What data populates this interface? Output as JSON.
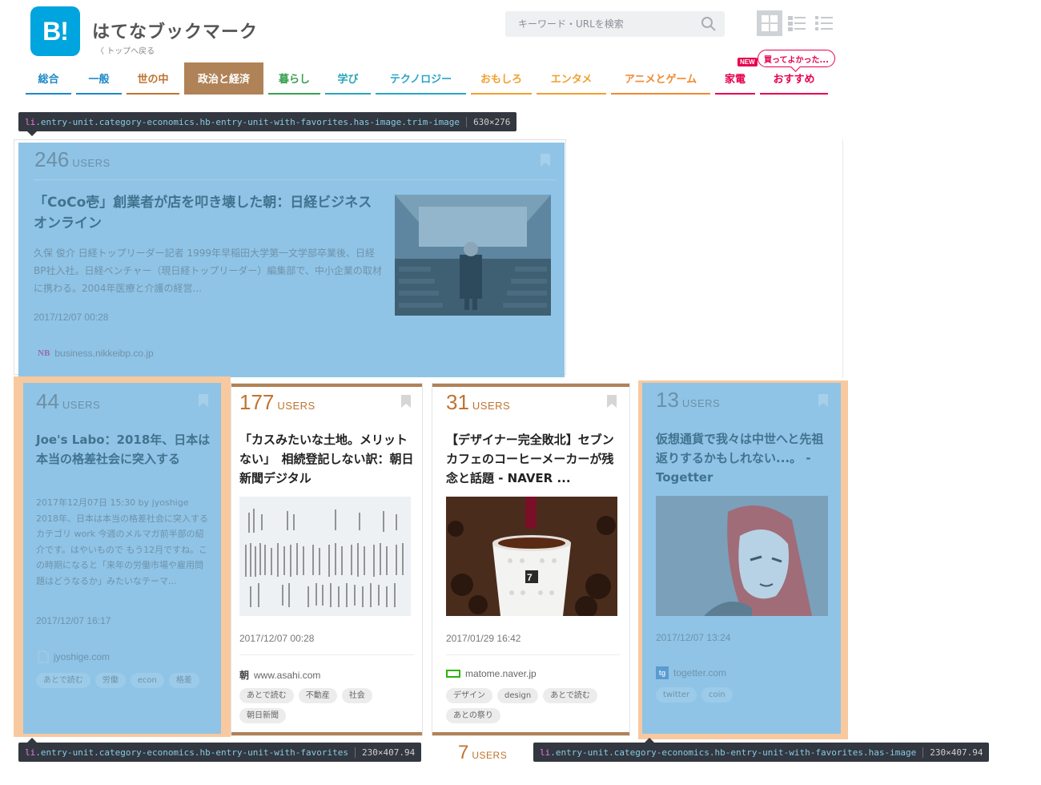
{
  "header": {
    "logo_text": "B!",
    "site_title": "はてなブックマーク",
    "back_link": "〈 トップへ戻る",
    "search_placeholder": "キーワード・URLを検索"
  },
  "nav": {
    "items": [
      {
        "label": "総合",
        "color": "#1e88c8"
      },
      {
        "label": "一般",
        "color": "#1e88c8"
      },
      {
        "label": "世の中",
        "color": "#c0732f"
      },
      {
        "label": "政治と経済",
        "color": "#b08257"
      },
      {
        "label": "暮らし",
        "color": "#3aa050"
      },
      {
        "label": "学び",
        "color": "#2aa6b8"
      },
      {
        "label": "テクノロジー",
        "color": "#2aa6c8"
      },
      {
        "label": "おもしろ",
        "color": "#f0a030"
      },
      {
        "label": "エンタメ",
        "color": "#f0a030"
      },
      {
        "label": "アニメとゲーム",
        "color": "#f08a30"
      },
      {
        "label": "家電",
        "color": "#e6004e"
      },
      {
        "label": "おすすめ",
        "color": "#e6004e"
      }
    ],
    "new_badge": "NEW",
    "bubble_text": "買ってよかった..."
  },
  "tooltips": {
    "top": {
      "selector_tag": "li",
      "selector_rest": ".entry-unit.category-economics.hb-entry-unit-with-favorites.has-image.trim-image",
      "size": "630×276"
    },
    "bottom_left": {
      "selector_tag": "li",
      "selector_rest": ".entry-unit.category-economics.hb-entry-unit-with-favorites",
      "size": "230×407.94"
    },
    "bottom_right": {
      "selector_tag": "li",
      "selector_rest": ".entry-unit.category-economics.hb-entry-unit-with-favorites.has-image",
      "size": "230×407.94"
    }
  },
  "entries": [
    {
      "users": "246",
      "users_label": "USERS",
      "title": "「CoCo壱」創業者が店を叩き壊した朝：日経ビジネスオンライン",
      "description": "久保 俊介 日経トップリーダー記者 1999年早稲田大学第一文学部卒業後、日経BP社入社。日経ベンチャー（現日経トップリーダー）編集部で、中小企業の取材に携わる。2004年医療と介護の経営...",
      "date": "2017/12/07 00:28",
      "favicon": "NB",
      "domain": "business.nikkeibp.co.jp",
      "tags": []
    },
    {
      "users": "44",
      "users_label": "USERS",
      "title": "Joe's Labo：2018年、日本は本当の格差社会に突入する",
      "description": "2017年12月07日 15:30 by jyoshige 2018年、日本は本当の格差社会に突入する カテゴリ work 今週のメルマガ前半部の紹介です。はやいもので もう12月ですね。この時期になると「来年の労働市場や雇用問題はどうなるか」みたいなテーマ...",
      "date": "2017/12/07 16:17",
      "domain": "jyoshige.com",
      "tags": [
        "あとで読む",
        "労働",
        "econ",
        "格差"
      ]
    },
    {
      "users": "177",
      "users_label": "USERS",
      "title": "「カスみたいな土地。メリットない」　相続登記しない訳：朝日新聞デジタル",
      "date": "2017/12/07 00:28",
      "favicon": "朝",
      "domain": "www.asahi.com",
      "tags": [
        "あとで読む",
        "不動産",
        "社会",
        "朝日新聞"
      ]
    },
    {
      "users": "31",
      "users_label": "USERS",
      "title": "【デザイナー完全敗北】セブンカフェのコーヒーメーカーが残念と話題 - NAVER ...",
      "date": "2017/01/29 16:42",
      "domain": "matome.naver.jp",
      "tags": [
        "デザイン",
        "design",
        "あとで読む",
        "あとの祭り"
      ]
    },
    {
      "users": "13",
      "users_label": "USERS",
      "title": "仮想通貨で我々は中世へと先祖返りするかもしれない...。 - Togetter",
      "date": "2017/12/07 13:24",
      "favicon": "tg",
      "domain": "togetter.com",
      "tags": [
        "twitter",
        "coin"
      ]
    },
    {
      "users": "7",
      "users_label": "USERS"
    }
  ],
  "colors": {
    "accent": "#00a4de",
    "economics": "#b08257",
    "highlight": "#8fc4e6",
    "margin_highlight": "#f8c99f"
  }
}
